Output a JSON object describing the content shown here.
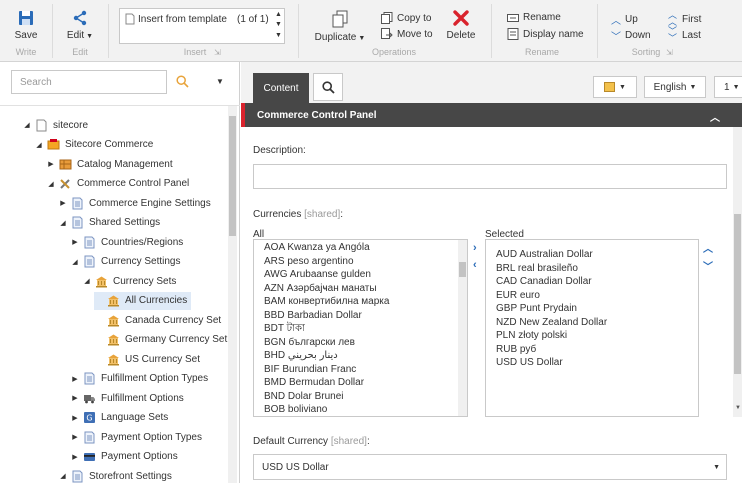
{
  "ribbon": {
    "write": {
      "save": "Save",
      "group": "Write"
    },
    "edit": {
      "edit": "Edit",
      "group": "Edit"
    },
    "insert": {
      "template_item": "Insert from template",
      "count": "(1 of 1)",
      "group": "Insert"
    },
    "operations": {
      "duplicate": "Duplicate",
      "copy_to": "Copy to",
      "move_to": "Move to",
      "delete": "Delete",
      "group": "Operations"
    },
    "rename": {
      "rename": "Rename",
      "display_name": "Display name",
      "group": "Rename"
    },
    "sorting": {
      "up": "Up",
      "down": "Down",
      "first": "First",
      "last": "Last",
      "group": "Sorting"
    }
  },
  "search": {
    "placeholder": "Search"
  },
  "tree": [
    {
      "label": "sitecore",
      "depth": 0,
      "arrow": "open",
      "icon": "page-icon"
    },
    {
      "label": "Sitecore Commerce",
      "depth": 1,
      "arrow": "open",
      "icon": "commerce-icon"
    },
    {
      "label": "Catalog Management",
      "depth": 2,
      "arrow": "closed",
      "icon": "catalog-icon"
    },
    {
      "label": "Commerce Control Panel",
      "depth": 2,
      "arrow": "open",
      "icon": "tools-icon"
    },
    {
      "label": "Commerce Engine Settings",
      "depth": 3,
      "arrow": "closed",
      "icon": "doc-icon"
    },
    {
      "label": "Shared Settings",
      "depth": 3,
      "arrow": "open",
      "icon": "doc-icon"
    },
    {
      "label": "Countries/Regions",
      "depth": 4,
      "arrow": "closed",
      "icon": "doc-icon"
    },
    {
      "label": "Currency Settings",
      "depth": 4,
      "arrow": "open",
      "icon": "doc-icon"
    },
    {
      "label": "Currency Sets",
      "depth": 5,
      "arrow": "open",
      "icon": "bank-icon"
    },
    {
      "label": "All Currencies",
      "depth": 6,
      "arrow": "none",
      "icon": "bank-icon",
      "selected": true
    },
    {
      "label": "Canada Currency Set",
      "depth": 6,
      "arrow": "none",
      "icon": "bank-icon"
    },
    {
      "label": "Germany Currency Set",
      "depth": 6,
      "arrow": "none",
      "icon": "bank-icon"
    },
    {
      "label": "US Currency Set",
      "depth": 6,
      "arrow": "none",
      "icon": "bank-icon"
    },
    {
      "label": "Fulfillment Option Types",
      "depth": 4,
      "arrow": "closed",
      "icon": "doc-icon"
    },
    {
      "label": "Fulfillment Options",
      "depth": 4,
      "arrow": "closed",
      "icon": "truck-icon"
    },
    {
      "label": "Language Sets",
      "depth": 4,
      "arrow": "closed",
      "icon": "language-icon"
    },
    {
      "label": "Payment Option Types",
      "depth": 4,
      "arrow": "closed",
      "icon": "doc-icon"
    },
    {
      "label": "Payment Options",
      "depth": 4,
      "arrow": "closed",
      "icon": "payment-icon"
    },
    {
      "label": "Storefront Settings",
      "depth": 3,
      "arrow": "open",
      "icon": "doc-icon"
    }
  ],
  "tabs": {
    "content": "Content"
  },
  "topbar": {
    "language": "English",
    "version": "1"
  },
  "panel": {
    "title": "Commerce Control Panel"
  },
  "fields": {
    "description_label": "Description:",
    "description_value": "",
    "currencies_label": "Currencies",
    "shared_tag": "[shared]",
    "colon": ":",
    "all_label": "All",
    "selected_label": "Selected",
    "default_currency_label": "Default Currency",
    "default_currency_value": "USD US Dollar"
  },
  "all_currencies": [
    "AOA Kwanza ya Angóla",
    "ARS peso argentino",
    "AWG Arubaanse gulden",
    "AZN Азәрбајҹан манаты",
    "BAM конвертибилна марка",
    "BBD Barbadian Dollar",
    "BDT টাকা",
    "BGN български лев",
    "BHD دينار بحريني",
    "BIF Burundian Franc",
    "BMD Bermudan Dollar",
    "BND Dolar Brunei",
    "BOB boliviano"
  ],
  "selected_currencies": [
    "AUD Australian Dollar",
    "BRL real brasileño",
    "CAD Canadian Dollar",
    "EUR euro",
    "GBP Punt Prydain",
    "NZD New Zealand Dollar",
    "PLN złoty polski",
    "RUB руб",
    "USD US Dollar"
  ],
  "colors": {
    "accent": "#2b6cb8",
    "delete": "#d9232d",
    "panel_head": "#474747",
    "selection": "#dfeaf7"
  }
}
